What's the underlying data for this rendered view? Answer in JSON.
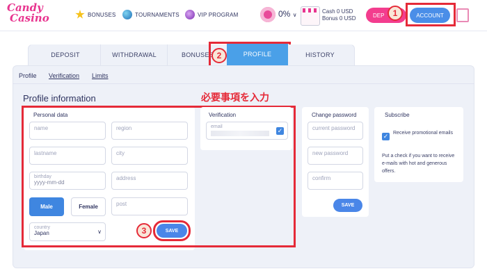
{
  "logo": {
    "line1": "Candy",
    "line2": "Casino"
  },
  "nav": {
    "bonuses": "BONUSES",
    "tournaments": "TOURNAMENTS",
    "vip": "VIP PROGRAM"
  },
  "balance": {
    "percent": "0%",
    "chevron": "∨",
    "cash": "Cash  0 USD",
    "bonus": "Bonus 0 USD"
  },
  "header_buttons": {
    "deposit": "DEP",
    "account": "ACCOUNT"
  },
  "tabs": {
    "deposit": "DEPOSIT",
    "withdrawal": "WITHDRAWAL",
    "bonuses": "BONUSES",
    "profile": "PROFILE",
    "history": "HISTORY"
  },
  "subnav": {
    "profile": "Profile",
    "verification": "Verification",
    "limits": "Limits"
  },
  "title": "Profile information",
  "annotation_jp": "必要事項を入力",
  "badges": {
    "b1": "1",
    "b2": "2",
    "b3": "3"
  },
  "personal": {
    "title": "Personal data",
    "name": "name",
    "region": "region",
    "lastname": "lastname",
    "city": "city",
    "birthday": "birthday",
    "birthday_fmt": "yyyy-mm-dd",
    "address": "address",
    "post": "post",
    "male": "Male",
    "female": "Female",
    "country_label": "country",
    "country_value": "Japan",
    "save": "SAVE"
  },
  "verification": {
    "title": "Verification",
    "email_label": "email",
    "check": "✓"
  },
  "password": {
    "title": "Change password",
    "current": "current password",
    "new": "new password",
    "confirm": "confirm",
    "save": "SAVE"
  },
  "subscribe": {
    "title": "Subscribe",
    "check_label": "Receive promotional emails",
    "check": "✓",
    "note": "Put a check if you want to receive e-mails with hot and generous offers."
  },
  "colors": {
    "accent": "#3f86e0",
    "brand_pink": "#e8358f",
    "annotation_red": "#e52a38"
  },
  "icons": {
    "star": "star-icon",
    "globe": "globe-icon",
    "vip": "vip-icon",
    "donut": "donut-icon",
    "shop": "shop-icon",
    "exit": "exit-icon",
    "chevron": "chevron-down-icon"
  }
}
